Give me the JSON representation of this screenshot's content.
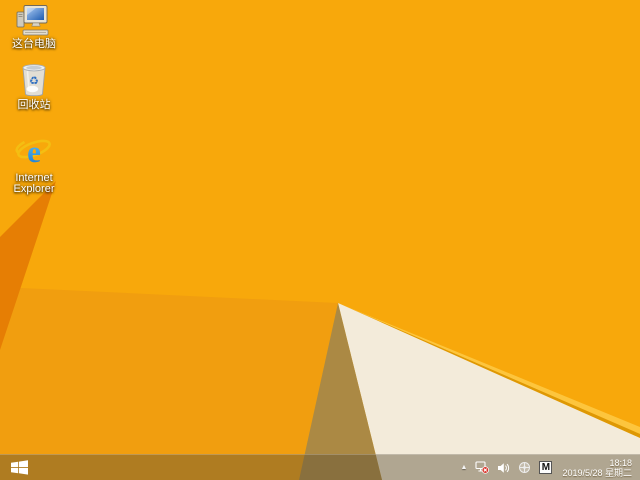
{
  "desktop": {
    "icons": [
      {
        "id": "this-pc",
        "label": "这台电脑"
      },
      {
        "id": "recycle-bin",
        "label": "回收站"
      },
      {
        "id": "internet-explorer",
        "label": "Internet Explorer"
      }
    ]
  },
  "taskbar": {
    "tray": {
      "hidden_icons_arrow": "▲",
      "input_indicator": "M",
      "clock": {
        "time": "18:18",
        "date": "2019/5/28 星期二"
      }
    }
  },
  "colors": {
    "wallpaper_base": "#F8A80B",
    "wallpaper_facet": "#F19E0F",
    "wallpaper_wedge": "#E67E04",
    "wallpaper_edge_light": "#FDC53D",
    "wallpaper_edge_dark": "#DE9804",
    "wallpaper_cream": "#F3EBDA",
    "wallpaper_tan": "#AB8944",
    "ie_blue_dark": "#1173D2",
    "ie_blue_light": "#6FD0F7",
    "ie_gold": "#F4BE12",
    "status_error_red": "#D9342B"
  }
}
